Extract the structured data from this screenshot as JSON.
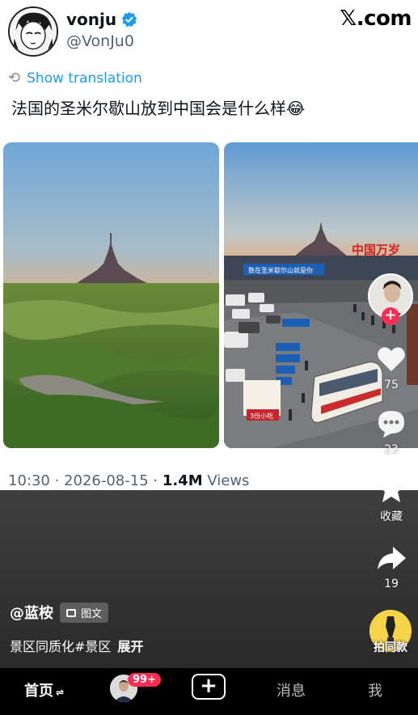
{
  "tweet": {
    "display_name": "vonju",
    "handle": "@VonJu0",
    "source_logo": "𝕏.com",
    "translate_label": "Show translation",
    "text": "法国的圣米尔歇山放到中国会是什么样😂",
    "meta_time": "10:30 · 2026-08-15 · ",
    "meta_views_count": "1.4M",
    "meta_views_label": " Views",
    "right_photo_banner": "中国万岁",
    "right_photo_sign": "数在圣米歇尔山就是你",
    "right_photo_stall": "3份小吃"
  },
  "video": {
    "author": "@蓝桉",
    "tag_label": "图文",
    "caption": "景区同质化#景区",
    "expand": "展开"
  },
  "rail": {
    "likes": "75",
    "comments": "23",
    "favorite_label": "收藏",
    "shares": "19",
    "same_style_label": "拍同款"
  },
  "nav": {
    "home": "首页",
    "friends_badge": "99+",
    "plus": "+",
    "messages": "消息",
    "me": "我"
  },
  "colors": {
    "link": "#1d9bf0",
    "accent": "#fe2c55",
    "verified": "#1d9bf0"
  }
}
